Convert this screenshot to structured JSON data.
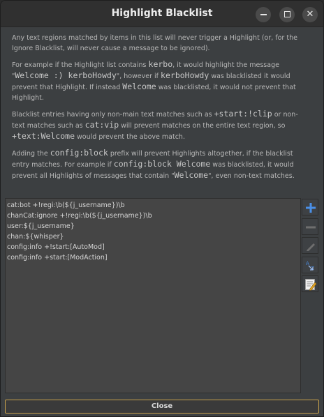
{
  "window": {
    "title": "Highlight Blacklist"
  },
  "controls": {
    "minimize": "–",
    "maximize": "□",
    "close": "✕"
  },
  "info": {
    "p1": "Any text regions matched by items in this list will never trigger a Highlight (or, for the Ignore Blacklist, will never cause a message to be ignored).",
    "p2_a": "For example if the Highlight list contains ",
    "p2_code1": "kerbo",
    "p2_b": ", it would highlight the message \"",
    "p2_code2": "Welcome :) kerboHowdy",
    "p2_c": "\", however if ",
    "p2_code3": "kerboHowdy",
    "p2_d": " was blacklisted it would prevent that Highlight. If instead ",
    "p2_code4": "Welcome",
    "p2_e": " was blacklisted, it would not prevent that Highlight.",
    "p3_a": "Blacklist entries having only non-main text matches such as ",
    "p3_code1": "+start:!clip",
    "p3_b": " or non-text matches such as ",
    "p3_code2": "cat:vip",
    "p3_c": " will prevent matches on the entire text region, so ",
    "p3_code3": "+text:Welcome",
    "p3_d": " would prevent the above match.",
    "p4_a": "Adding the ",
    "p4_code1": "config:block",
    "p4_b": " prefix will prevent Highlights altogether, if the blacklist entry matches. For example if ",
    "p4_code2": "config:block Welcome",
    "p4_c": " was blacklisted, it would prevent all Highlights of messages that contain \"",
    "p4_code3": "Welcome",
    "p4_d": "\", even non-text matches."
  },
  "entries": [
    "cat:bot +!regi:\\b(${j_username})\\b",
    "chanCat:ignore +!regi:\\b(${j_username})\\b",
    "user:${j_username}",
    "chan:${whisper}",
    "config:info +!start:[AutoMod]",
    "config:info +start:[ModAction]"
  ],
  "buttons": {
    "close": "Close"
  },
  "icons": {
    "add": "plus-icon",
    "remove": "minus-icon",
    "edit": "pencil-icon",
    "sort": "sort-icon",
    "edit_all": "edit-list-icon"
  },
  "colors": {
    "accent": "#3a7bd5",
    "footer_border": "#c8a24c"
  }
}
